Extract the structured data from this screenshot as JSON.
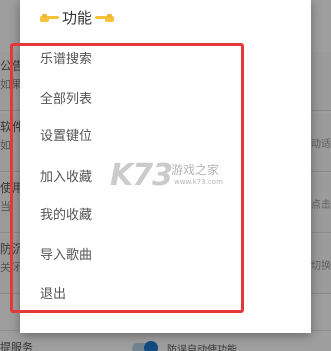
{
  "dialog": {
    "title": "功能",
    "items": [
      {
        "label": "乐谱搜索"
      },
      {
        "label": "全部列表"
      },
      {
        "label": "设置键位"
      },
      {
        "label": "加入收藏"
      },
      {
        "label": "我的收藏"
      },
      {
        "label": "导入歌曲"
      },
      {
        "label": "退出"
      }
    ]
  },
  "background": {
    "rows": [
      {
        "left": "公告",
        "sub": "如果",
        "right": ""
      },
      {
        "left": "软件",
        "sub": "如",
        "right": "动适"
      },
      {
        "left": "使用",
        "sub": "当",
        "right": "点击"
      },
      {
        "left": "防沉",
        "sub": "关闭",
        "right": "切换"
      }
    ],
    "bottom_left": "提服务",
    "bottom_right": "防误自动使功能"
  },
  "watermark": {
    "logo": "K73",
    "text": "游戏之家",
    "sub": "www.k73.com"
  },
  "colors": {
    "highlight_frame": "#e5383b",
    "toggle_accent": "#1f7acf",
    "hand_icon": "#f5c23a"
  }
}
